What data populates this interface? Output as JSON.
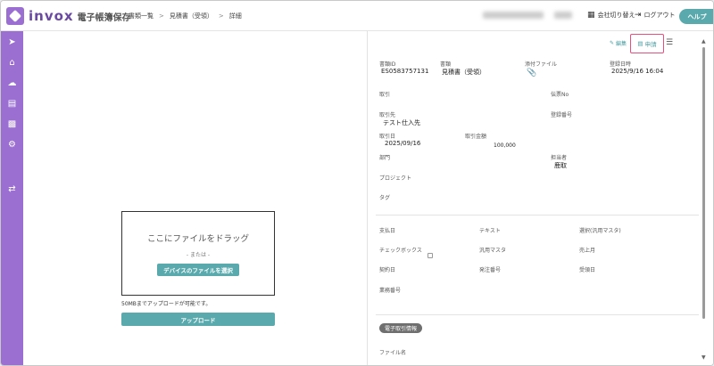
{
  "app": {
    "name": "invox",
    "subtitle": "電子帳簿保存"
  },
  "breadcrumb": [
    "書類一覧",
    "見積書（受領）",
    "詳細"
  ],
  "header": {
    "switch_company": "会社切り替え",
    "logout": "ログアウト",
    "help": "ヘルプ"
  },
  "sidebar_icons": [
    "arrow-right-circle-icon",
    "home-icon",
    "cloud-upload-icon",
    "document-icon",
    "chart-icon",
    "gear-icon",
    "swap-icon"
  ],
  "upload": {
    "drop_title": "ここにファイルをドラッグ",
    "or": "- または -",
    "select_button": "デバイスのファイルを選択",
    "note": "50MBまでアップロードが可能です。",
    "upload_button": "アップロード"
  },
  "toolbar": {
    "edit": "編集",
    "apply": "申請"
  },
  "fields": {
    "doc_id_label": "書類ID",
    "doc_id_value": "ES0583757131",
    "doc_type_label": "書類",
    "doc_type_value": "見積書（受領）",
    "attachment_label": "添付ファイル",
    "registered_label": "登録日時",
    "registered_value": "2025/9/16 16:04",
    "transaction_label": "取引",
    "slip_no_label": "伝票No",
    "partner_label": "取引先",
    "partner_value": "テスト仕入先",
    "reg_no_label": "登録番号",
    "trade_date_label": "取引日",
    "trade_date_value": "2025/09/16",
    "amount_label": "取引金額",
    "amount_value": "100,000",
    "dept_label": "部門",
    "person_label": "担当者",
    "person_value": "鹿取",
    "project_label": "プロジェクト",
    "tag_label": "タグ",
    "pay_date_label": "支払日",
    "text_label": "テキスト",
    "select_label": "選択(汎用マスタ)",
    "checkbox_label": "チェックボックス",
    "master_label": "汎用マスタ",
    "sales_month_label": "売上月",
    "contract_date_label": "契約日",
    "order_no_label": "発注番号",
    "receive_date_label": "受領日",
    "business_no_label": "業務番号",
    "section_etrans": "電子取引情報",
    "file_name_label": "ファイル名"
  },
  "colors": {
    "brand": "#9b6fd2",
    "accent": "#5aa9ad",
    "highlight": "#e8507c"
  }
}
